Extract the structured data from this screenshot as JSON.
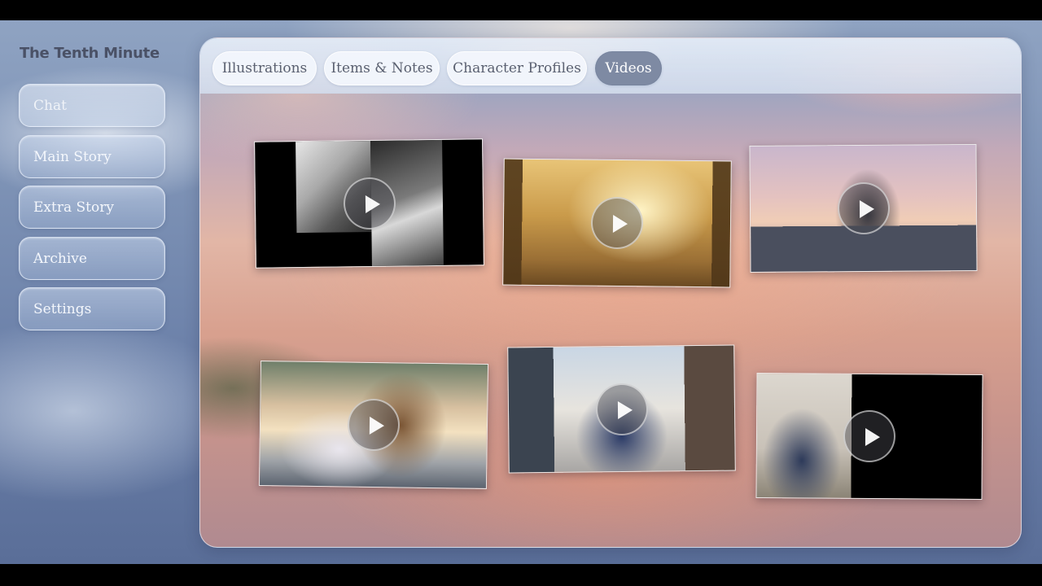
{
  "app": {
    "title": "The Tenth Minute"
  },
  "sidebar": {
    "items": [
      {
        "label": "Chat"
      },
      {
        "label": "Main Story"
      },
      {
        "label": "Extra Story"
      },
      {
        "label": "Archive"
      },
      {
        "label": "Settings"
      }
    ]
  },
  "tabs": [
    {
      "label": "Illustrations"
    },
    {
      "label": "Items & Notes"
    },
    {
      "label": "Character Profiles"
    },
    {
      "label": "Videos",
      "active": true
    }
  ],
  "videos": [
    {
      "thumbnail": "manga-two-girls",
      "icon": "play-icon"
    },
    {
      "thumbnail": "sunlit-window",
      "icon": "play-icon"
    },
    {
      "thumbnail": "girl-on-bridge-sunset",
      "icon": "play-icon"
    },
    {
      "thumbnail": "girl-playing-flute",
      "icon": "play-icon"
    },
    {
      "thumbnail": "girl-in-street",
      "icon": "play-icon"
    },
    {
      "thumbnail": "boy-waving",
      "icon": "play-icon"
    }
  ],
  "colors": {
    "active_tab": "#7e8aa3",
    "tab_text": "#5a6070",
    "title_text": "#4a5166"
  }
}
